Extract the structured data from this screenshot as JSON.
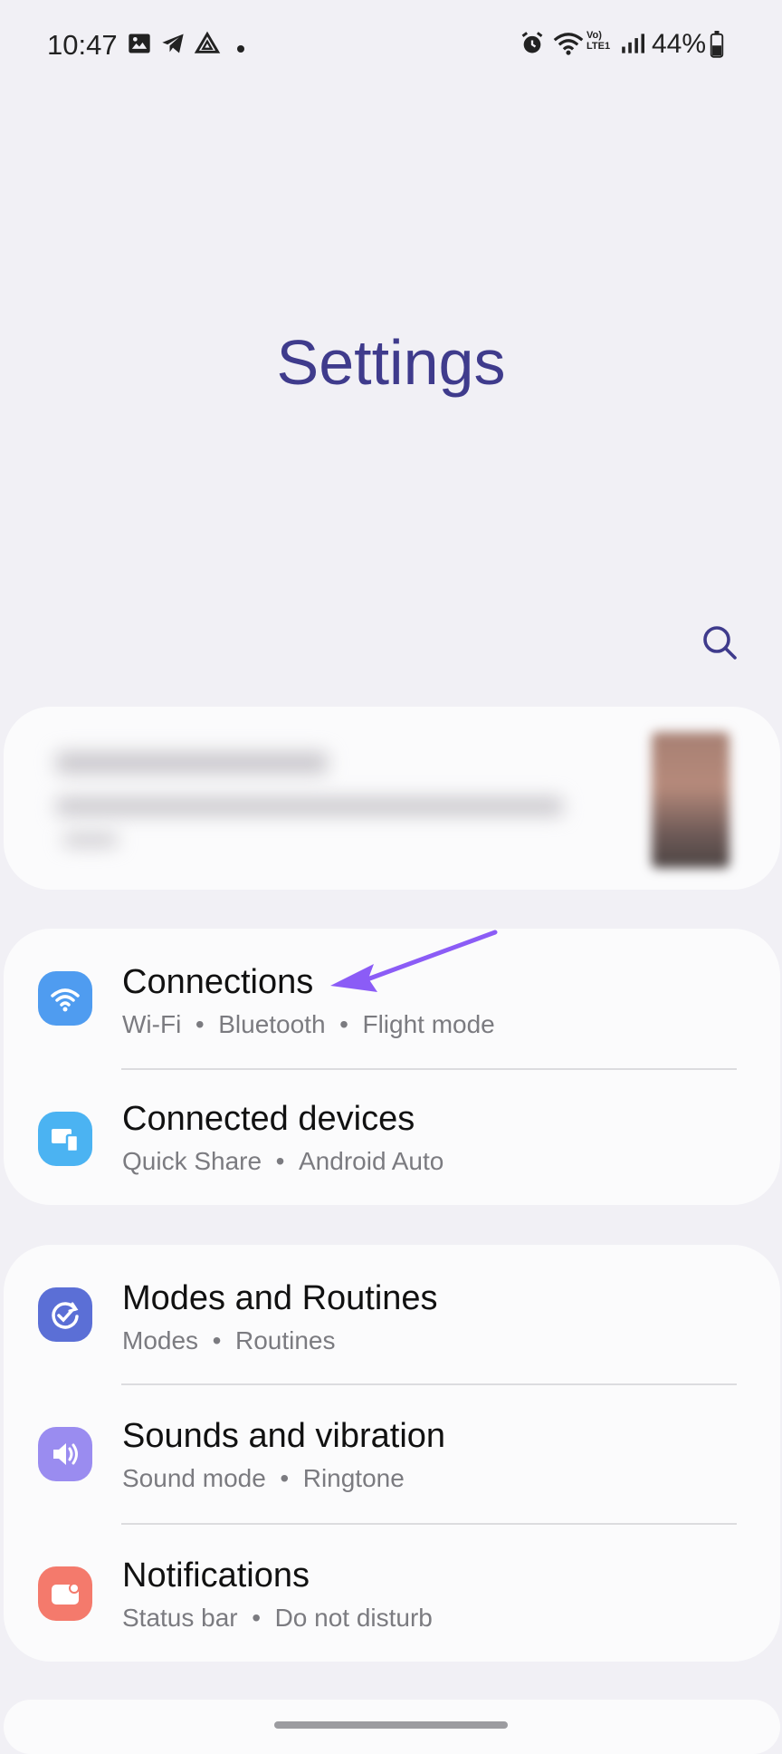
{
  "status_bar": {
    "time": "10:47",
    "network": "Vo) LTE1",
    "battery": "44%"
  },
  "page": {
    "title": "Settings"
  },
  "settings": {
    "connections": {
      "title": "Connections",
      "subtitle": [
        "Wi-Fi",
        "Bluetooth",
        "Flight mode"
      ]
    },
    "connected_devices": {
      "title": "Connected devices",
      "subtitle": [
        "Quick Share",
        "Android Auto"
      ]
    },
    "modes_routines": {
      "title": "Modes and Routines",
      "subtitle": [
        "Modes",
        "Routines"
      ]
    },
    "sounds": {
      "title": "Sounds and vibration",
      "subtitle": [
        "Sound mode",
        "Ringtone"
      ]
    },
    "notifications": {
      "title": "Notifications",
      "subtitle": [
        "Status bar",
        "Do not disturb"
      ]
    }
  },
  "colors": {
    "title": "#3f3b8c",
    "connections_icon": "#4f9cf0",
    "connected_devices_icon": "#4bb3f2",
    "modes_icon": "#5b6fd6",
    "sounds_icon": "#9a8cf0",
    "notifications_icon": "#f47a6c",
    "arrow": "#8b5cf6"
  },
  "icons": [
    "image-icon",
    "telegram-icon",
    "drive-icon",
    "alarm-icon",
    "wifi-icon",
    "signal-icon",
    "battery-icon",
    "search-icon",
    "wifi-settings-icon",
    "devices-icon",
    "routines-icon",
    "speaker-icon",
    "notification-icon",
    "annotation-arrow-icon"
  ]
}
